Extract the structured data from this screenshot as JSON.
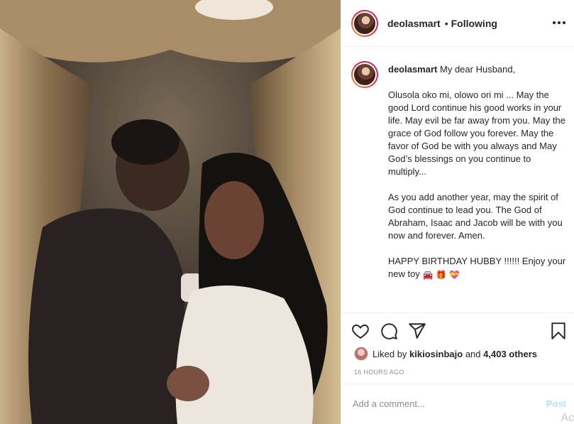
{
  "post": {
    "username": "deolasmart",
    "separator": "•",
    "follow_status": "Following"
  },
  "caption": {
    "username": "deolasmart",
    "greeting": "My dear Husband,",
    "paragraph1": "Olusola oko mi, olowo ori mi ... May the good Lord continue his good works in your life. May evil be far away from you. May the grace of God follow you forever. May the favor of God be with you always and May God’s blessings on you continue to multiply...",
    "paragraph2": "As you add another year, may the spirit of God continue to lead you. The God of Abraham, Isaac and Jacob will be with you now and forever. Amen.",
    "paragraph3": "HAPPY BIRTHDAY HUBBY !!!!!! Enjoy your new toy",
    "emojis": [
      "🚘",
      "🎁",
      "💝"
    ]
  },
  "likes": {
    "prefix": "Liked by",
    "user": "kikiosinbajo",
    "and": "and",
    "count": "4,403 others"
  },
  "timestamp": "16 HOURS AGO",
  "comment_box": {
    "placeholder": "Add a comment...",
    "post_label": "Post"
  },
  "overlay_text": "Ac",
  "icons": [
    "heart-icon",
    "comment-icon",
    "share-icon",
    "bookmark-icon",
    "more-options-icon"
  ],
  "colors": {
    "accent": "#b2dffc",
    "muted": "#8e8e8e",
    "text": "#262626"
  }
}
